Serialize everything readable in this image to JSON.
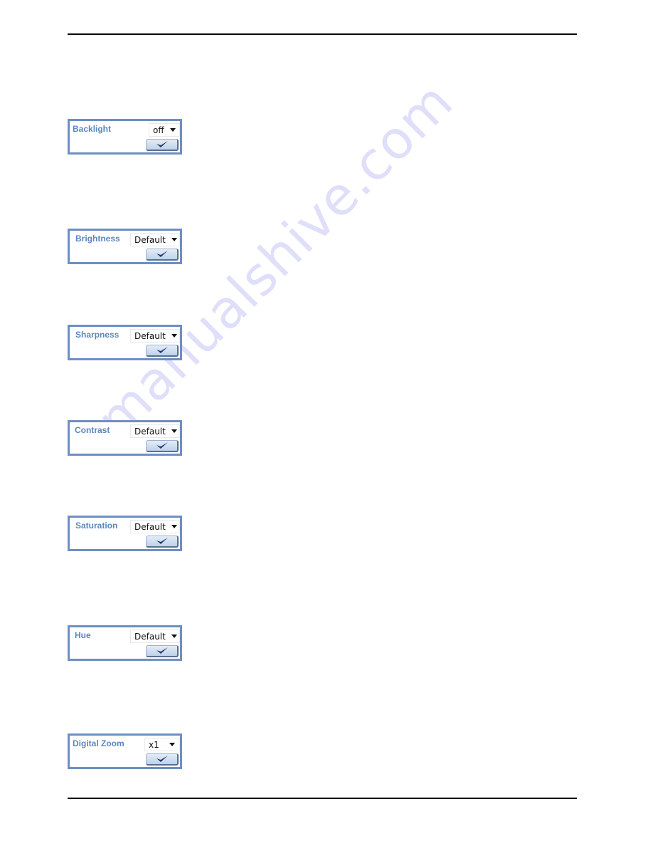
{
  "watermark": "manualshive.com",
  "widgets": [
    {
      "id": "backlight",
      "label": "Backlight",
      "value": "off",
      "apply_icon": "checkmark-icon"
    },
    {
      "id": "brightness",
      "label": "Brightness",
      "value": "Default",
      "apply_icon": "checkmark-icon"
    },
    {
      "id": "sharpness",
      "label": "Sharpness",
      "value": "Default",
      "apply_icon": "checkmark-icon"
    },
    {
      "id": "contrast",
      "label": "Contrast",
      "value": "Default",
      "apply_icon": "checkmark-icon"
    },
    {
      "id": "saturation",
      "label": "Saturation",
      "value": "Default",
      "apply_icon": "checkmark-icon"
    },
    {
      "id": "hue",
      "label": "Hue",
      "value": "Default",
      "apply_icon": "checkmark-icon"
    },
    {
      "id": "digital-zoom",
      "label": "Digital Zoom",
      "value": "x1",
      "apply_icon": "checkmark-icon"
    }
  ],
  "colors": {
    "widget_border": "#6d8fc2",
    "label_text": "#5c86bd",
    "checkmark": "#1f3a6b",
    "watermark": "#dcdcfa"
  }
}
